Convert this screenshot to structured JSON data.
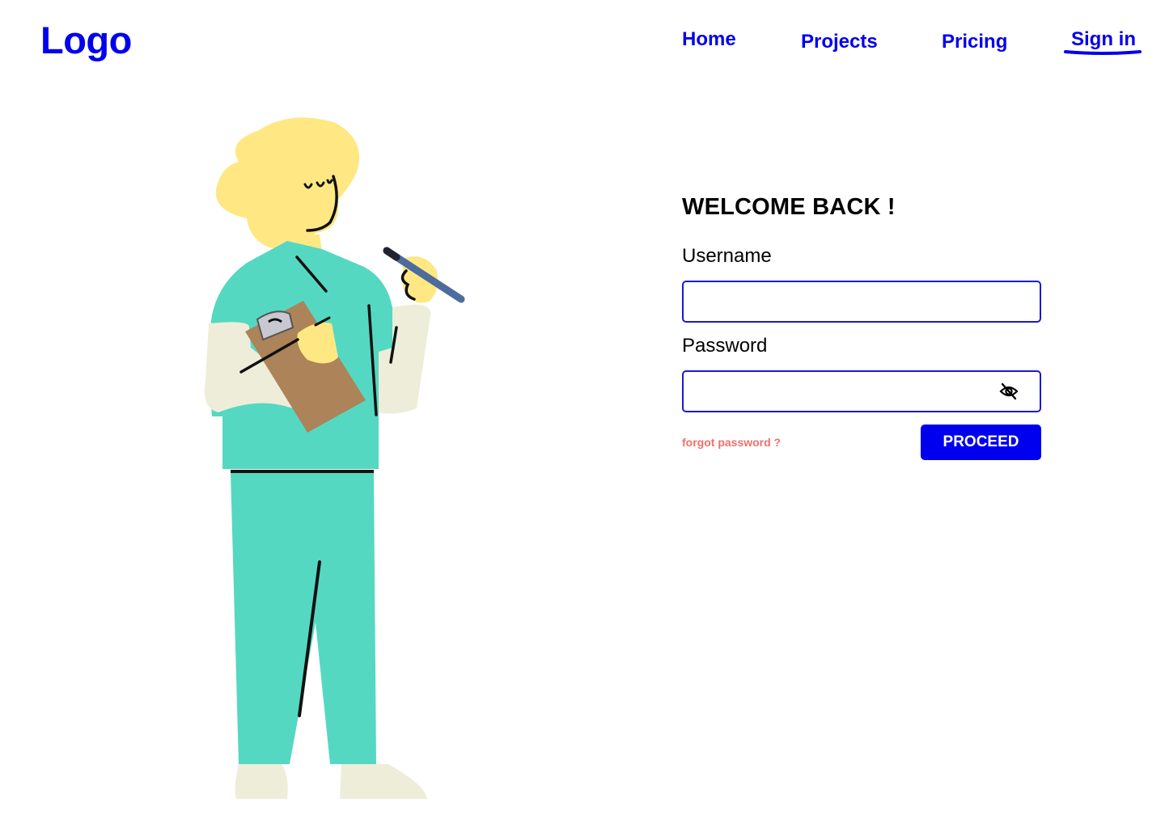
{
  "header": {
    "logo": "Logo",
    "nav": {
      "home": "Home",
      "projects": "Projects",
      "pricing": "Pricing",
      "signin": "Sign in"
    }
  },
  "login": {
    "heading": "WELCOME BACK !",
    "username_label": "Username",
    "username_value": "",
    "password_label": "Password",
    "password_value": "",
    "password_toggle_icon": "eye-off-icon",
    "forgot_link": "forgot password ?",
    "proceed_label": "PROCEED"
  },
  "colors": {
    "accent": "#0000ee",
    "input_border": "#1b1bcc",
    "forgot_link": "#f0706a",
    "illustration_scrubs": "#55d8c1",
    "illustration_hair": "#ffe883",
    "illustration_clipboard": "#ad8359"
  }
}
